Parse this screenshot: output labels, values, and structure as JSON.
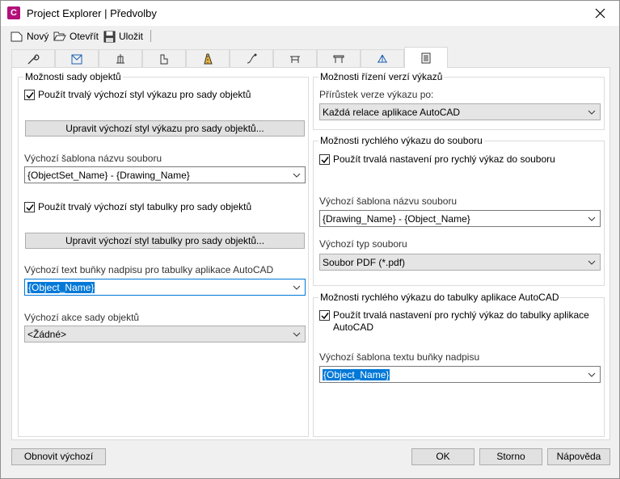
{
  "window": {
    "title": "Project Explorer | Předvolby",
    "app_icon_letter": "C"
  },
  "toolbar": {
    "new_label": "Nový",
    "open_label": "Otevřít",
    "save_label": "Uložit"
  },
  "tabs": [
    {
      "icon": "wrench-icon"
    },
    {
      "icon": "sheet-view-icon"
    },
    {
      "icon": "section-icon"
    },
    {
      "icon": "elevation-icon"
    },
    {
      "icon": "road-icon"
    },
    {
      "icon": "alignment-icon"
    },
    {
      "icon": "bridge-icon"
    },
    {
      "icon": "bridge-deck-icon"
    },
    {
      "icon": "survey-icon"
    },
    {
      "icon": "report-icon",
      "active": true
    }
  ],
  "left": {
    "group_title": "Možnosti sady objektů",
    "check1_label": "Použít trvalý výchozí styl výkazu pro sady objektů",
    "check1_checked": true,
    "button1_label": "Upravit výchozí styl výkazu pro sady objektů...",
    "filename_label": "Výchozí šablona názvu souboru",
    "filename_value": "{ObjectSet_Name} - {Drawing_Name}",
    "check2_label": "Použít trvalý výchozí styl tabulky pro sady objektů",
    "check2_checked": true,
    "button2_label": "Upravit výchozí styl tabulky pro sady objektů...",
    "cell_text_label": "Výchozí text buňky nadpisu pro tabulky aplikace AutoCAD",
    "cell_text_value": "{Object_Name}",
    "action_label": "Výchozí akce sady objektů",
    "action_value": "<Žádné>"
  },
  "right_version": {
    "group_title": "Možnosti řízení verzí výkazů",
    "increment_label": "Přírůstek verze výkazu po:",
    "increment_value": "Každá relace aplikace AutoCAD"
  },
  "right_quickfile": {
    "group_title": "Možnosti rychlého výkazu do souboru",
    "check_label": "Použít trvalá nastavení pro rychlý výkaz do souboru",
    "check_checked": true,
    "filename_label": "Výchozí šablona názvu souboru",
    "filename_value": "{Drawing_Name} - {Object_Name}",
    "filetype_label": "Výchozí typ souboru",
    "filetype_value": "Soubor PDF (*.pdf)"
  },
  "right_quicktable": {
    "group_title": "Možnosti rychlého výkazu do tabulky aplikace AutoCAD",
    "check_label_line1": "Použít trvalá nastavení pro rychlý výkaz do tabulky aplikace",
    "check_label_line2": "AutoCAD",
    "check_checked": true,
    "cell_text_label": "Výchozí šablona textu buňky nadpisu",
    "cell_text_value": "{Object_Name}"
  },
  "footer": {
    "reset_label": "Obnovit výchozí",
    "ok_label": "OK",
    "cancel_label": "Storno",
    "help_label": "Nápověda"
  }
}
